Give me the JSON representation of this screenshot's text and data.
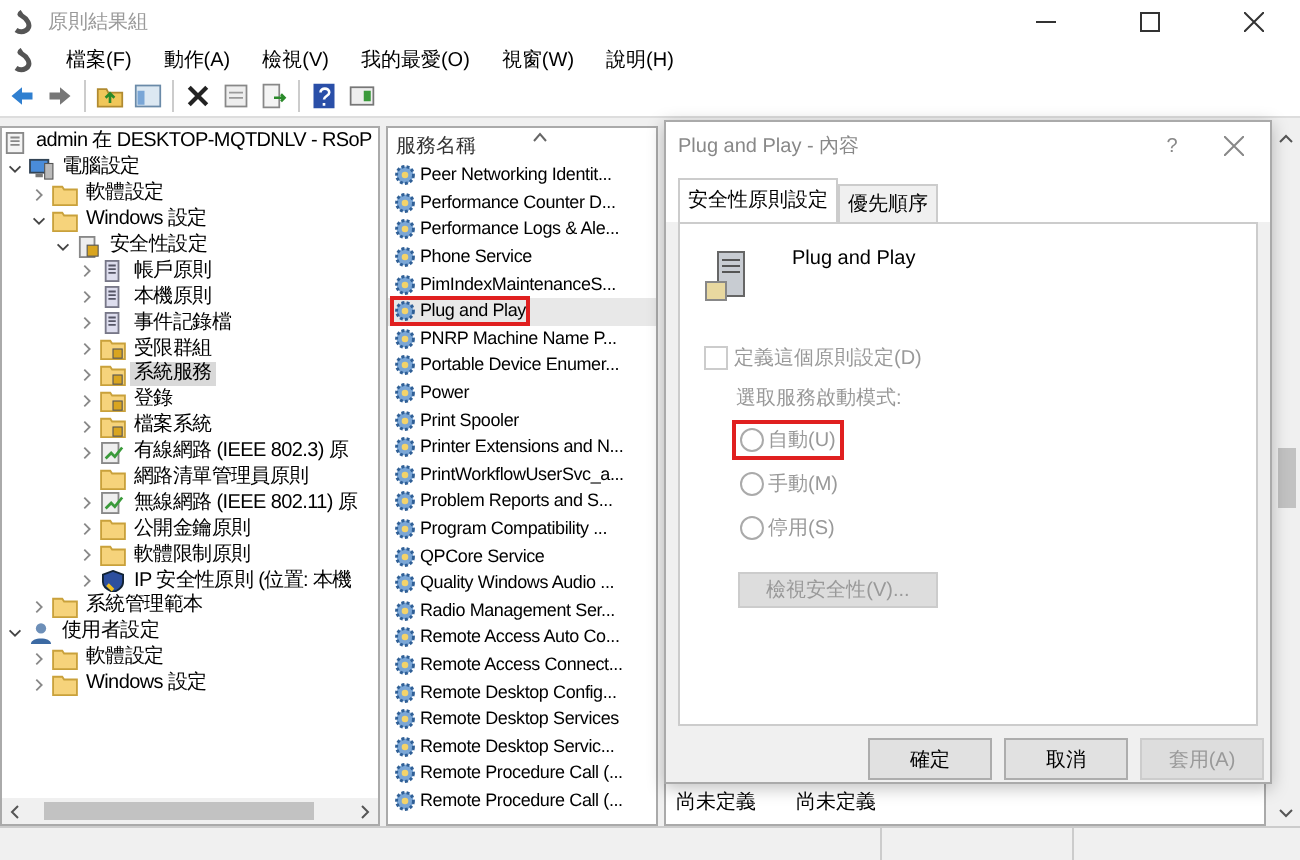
{
  "window": {
    "title": "原則結果組"
  },
  "menu": [
    "檔案(F)",
    "動作(A)",
    "檢視(V)",
    "我的最愛(O)",
    "視窗(W)",
    "說明(H)"
  ],
  "tree": [
    {
      "label": "admin 在 DESKTOP-MQTDNLV - RSoP",
      "kind": "doc",
      "expandable": false,
      "selected": false,
      "children": [
        {
          "label": "電腦設定",
          "kind": "computer",
          "expandable": true,
          "expanded": true,
          "selected": false,
          "children": [
            {
              "label": "軟體設定",
              "kind": "folder",
              "expandable": true,
              "expanded": false,
              "selected": false
            },
            {
              "label": "Windows 設定",
              "kind": "folder",
              "expandable": true,
              "expanded": true,
              "selected": false,
              "children": [
                {
                  "label": "安全性設定",
                  "kind": "shield",
                  "expandable": true,
                  "expanded": true,
                  "selected": false,
                  "children": [
                    {
                      "label": "帳戶原則",
                      "kind": "server",
                      "expandable": true,
                      "expanded": false,
                      "selected": false
                    },
                    {
                      "label": "本機原則",
                      "kind": "server",
                      "expandable": true,
                      "expanded": false,
                      "selected": false
                    },
                    {
                      "label": "事件記錄檔",
                      "kind": "server",
                      "expandable": true,
                      "expanded": false,
                      "selected": false
                    },
                    {
                      "label": "受限群組",
                      "kind": "lockfolder",
                      "expandable": true,
                      "expanded": false,
                      "selected": false
                    },
                    {
                      "label": "系統服務",
                      "kind": "lockfolder",
                      "expandable": true,
                      "expanded": false,
                      "selected": true
                    },
                    {
                      "label": "登錄",
                      "kind": "lockfolder",
                      "expandable": true,
                      "expanded": false,
                      "selected": false
                    },
                    {
                      "label": "檔案系統",
                      "kind": "lockfolder",
                      "expandable": true,
                      "expanded": false,
                      "selected": false
                    },
                    {
                      "label": "有線網路 (IEEE 802.3) 原",
                      "kind": "network",
                      "expandable": true,
                      "expanded": false,
                      "selected": false
                    },
                    {
                      "label": "網路清單管理員原則",
                      "kind": "folder",
                      "expandable": false,
                      "selected": false
                    },
                    {
                      "label": "無線網路 (IEEE 802.11) 原",
                      "kind": "network",
                      "expandable": true,
                      "expanded": false,
                      "selected": false
                    },
                    {
                      "label": "公開金鑰原則",
                      "kind": "folder",
                      "expandable": true,
                      "expanded": false,
                      "selected": false
                    },
                    {
                      "label": "軟體限制原則",
                      "kind": "folder",
                      "expandable": true,
                      "expanded": false,
                      "selected": false
                    },
                    {
                      "label": "IP 安全性原則 (位置: 本機",
                      "kind": "ipsec",
                      "expandable": true,
                      "expanded": false,
                      "selected": false
                    }
                  ]
                }
              ]
            },
            {
              "label": "系統管理範本",
              "kind": "folder",
              "expandable": true,
              "expanded": false,
              "selected": false
            }
          ]
        },
        {
          "label": "使用者設定",
          "kind": "user",
          "expandable": true,
          "expanded": true,
          "selected": false,
          "children": [
            {
              "label": "軟體設定",
              "kind": "folder",
              "expandable": true,
              "expanded": false,
              "selected": false
            },
            {
              "label": "Windows 設定",
              "kind": "folder",
              "expandable": true,
              "expanded": false,
              "selected": false
            }
          ]
        }
      ]
    }
  ],
  "services": {
    "column": "服務名稱",
    "items": [
      {
        "name": "Peer Networking Identit...",
        "selected": false,
        "annotated": false
      },
      {
        "name": "Performance Counter D...",
        "selected": false,
        "annotated": false
      },
      {
        "name": "Performance Logs & Ale...",
        "selected": false,
        "annotated": false
      },
      {
        "name": "Phone Service",
        "selected": false,
        "annotated": false
      },
      {
        "name": "PimIndexMaintenanceS...",
        "selected": false,
        "annotated": false
      },
      {
        "name": "Plug and Play",
        "selected": true,
        "annotated": true
      },
      {
        "name": "PNRP Machine Name P...",
        "selected": false,
        "annotated": false
      },
      {
        "name": "Portable Device Enumer...",
        "selected": false,
        "annotated": false
      },
      {
        "name": "Power",
        "selected": false,
        "annotated": false
      },
      {
        "name": "Print Spooler",
        "selected": false,
        "annotated": false
      },
      {
        "name": "Printer Extensions and N...",
        "selected": false,
        "annotated": false
      },
      {
        "name": "PrintWorkflowUserSvc_a...",
        "selected": false,
        "annotated": false
      },
      {
        "name": "Problem Reports and S...",
        "selected": false,
        "annotated": false
      },
      {
        "name": "Program Compatibility ...",
        "selected": false,
        "annotated": false
      },
      {
        "name": "QPCore Service",
        "selected": false,
        "annotated": false
      },
      {
        "name": "Quality Windows Audio ...",
        "selected": false,
        "annotated": false
      },
      {
        "name": "Radio Management Ser...",
        "selected": false,
        "annotated": false
      },
      {
        "name": "Remote Access Auto Co...",
        "selected": false,
        "annotated": false
      },
      {
        "name": "Remote Access Connect...",
        "selected": false,
        "annotated": false
      },
      {
        "name": "Remote Desktop Config...",
        "selected": false,
        "annotated": false
      },
      {
        "name": "Remote Desktop Services",
        "selected": false,
        "annotated": false
      },
      {
        "name": "Remote Desktop Servic...",
        "selected": false,
        "annotated": false
      },
      {
        "name": "Remote Procedure Call (...",
        "selected": false,
        "annotated": false
      },
      {
        "name": "Remote Procedure Call (...",
        "selected": false,
        "annotated": false
      }
    ]
  },
  "detail_rows": [
    {
      "column_2": "尚未定義",
      "column_3": "尚未定義"
    }
  ],
  "dialog": {
    "title": "Plug and Play - 內容",
    "help": "?",
    "tabs": [
      {
        "label": "安全性原則設定",
        "selected": true
      },
      {
        "label": "優先順序",
        "selected": false
      }
    ],
    "service_name": "Plug and Play",
    "define_checkbox": {
      "label": "定義這個原則設定(D)",
      "checked": false,
      "disabled": true
    },
    "startup_label": "選取服務啟動模式:",
    "startup_modes": [
      {
        "label": "自動(U)",
        "selected": false,
        "annotated": true
      },
      {
        "label": "手動(M)",
        "selected": false,
        "annotated": false
      },
      {
        "label": "停用(S)",
        "selected": false,
        "annotated": false
      }
    ],
    "security_button": {
      "label": "檢視安全性(V)...",
      "disabled": true
    },
    "buttons": [
      {
        "label": "確定",
        "disabled": false
      },
      {
        "label": "取消",
        "disabled": false
      },
      {
        "label": "套用(A)",
        "disabled": true
      }
    ]
  }
}
